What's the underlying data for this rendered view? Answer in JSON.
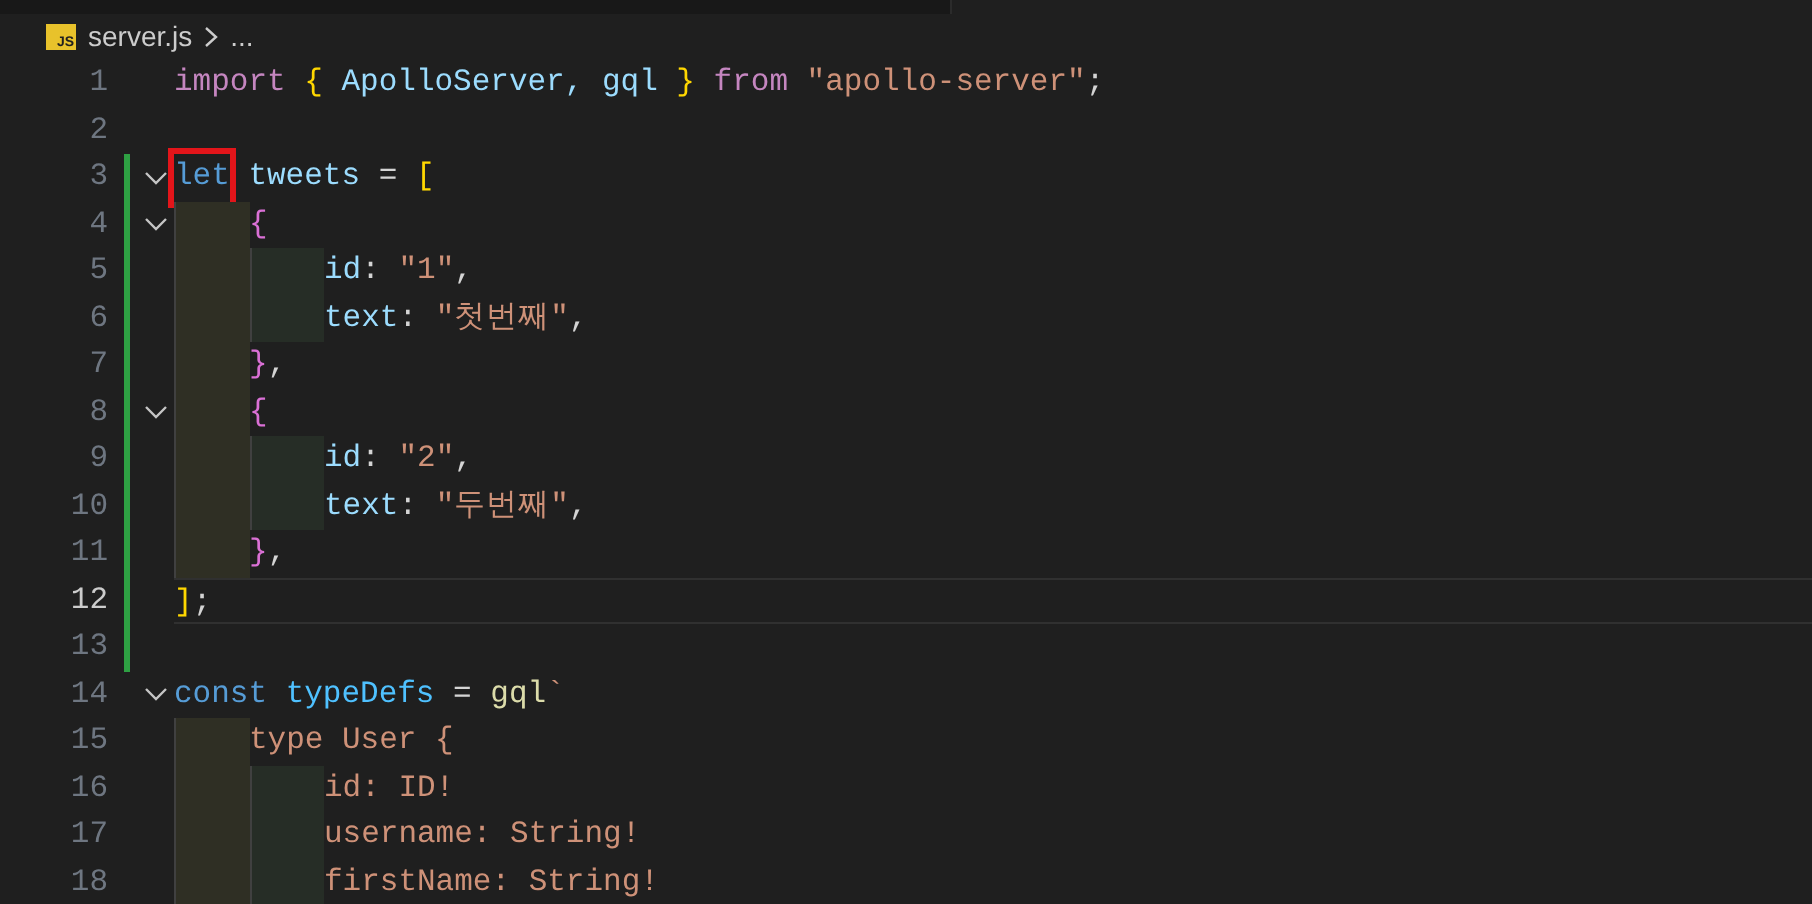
{
  "breadcrumb": {
    "file_icon": "JS",
    "file": "server.js",
    "rest": "..."
  },
  "lines": [
    {
      "number": "1",
      "foldable": false,
      "changed": false,
      "current": false,
      "tokens": [
        {
          "text": "import ",
          "kind": "control"
        },
        {
          "text": "{",
          "kind": "bracket1"
        },
        {
          "text": " ApolloServer, gql ",
          "kind": "variable"
        },
        {
          "text": "}",
          "kind": "bracket1"
        },
        {
          "text": " from ",
          "kind": "control"
        },
        {
          "text": "\"apollo-server\"",
          "kind": "string"
        },
        {
          "text": ";",
          "kind": "plain"
        }
      ]
    },
    {
      "number": "2",
      "foldable": false,
      "changed": false,
      "current": false
    },
    {
      "number": "3",
      "foldable": true,
      "changed": true,
      "current": false,
      "tokens": [
        {
          "text": "let",
          "kind": "storage",
          "boxed": true
        },
        {
          "text": " tweets ",
          "kind": "variable"
        },
        {
          "text": "= ",
          "kind": "plain"
        },
        {
          "text": "[",
          "kind": "bracket1"
        }
      ],
      "children": [
        {
          "number": "4",
          "foldable": true,
          "changed": true,
          "current": false,
          "tokens": [
            {
              "text": "{",
              "kind": "bracket2"
            }
          ],
          "children": [
            {
              "number": "5",
              "foldable": false,
              "changed": true,
              "current": false,
              "tokens": [
                {
                  "text": "id",
                  "kind": "variable"
                },
                {
                  "text": ": ",
                  "kind": "plain"
                },
                {
                  "text": "\"1\"",
                  "kind": "string"
                },
                {
                  "text": ",",
                  "kind": "plain"
                }
              ]
            },
            {
              "number": "6",
              "foldable": false,
              "changed": true,
              "current": false,
              "tokens": [
                {
                  "text": "text",
                  "kind": "variable"
                },
                {
                  "text": ": ",
                  "kind": "plain"
                },
                {
                  "text": "\"첫번째\"",
                  "kind": "string"
                },
                {
                  "text": ",",
                  "kind": "plain"
                }
              ]
            }
          ]
        },
        {
          "number": "7",
          "foldable": false,
          "changed": true,
          "current": false,
          "tokens": [
            {
              "text": "}",
              "kind": "bracket2"
            },
            {
              "text": ",",
              "kind": "plain"
            }
          ]
        },
        {
          "number": "8",
          "foldable": true,
          "changed": true,
          "current": false,
          "tokens": [
            {
              "text": "{",
              "kind": "bracket2"
            }
          ],
          "children": [
            {
              "number": "9",
              "foldable": false,
              "changed": true,
              "current": false,
              "tokens": [
                {
                  "text": "id",
                  "kind": "variable"
                },
                {
                  "text": ": ",
                  "kind": "plain"
                },
                {
                  "text": "\"2\"",
                  "kind": "string"
                },
                {
                  "text": ",",
                  "kind": "plain"
                }
              ]
            },
            {
              "number": "10",
              "foldable": false,
              "changed": true,
              "current": false,
              "tokens": [
                {
                  "text": "text",
                  "kind": "variable"
                },
                {
                  "text": ": ",
                  "kind": "plain"
                },
                {
                  "text": "\"두번째\"",
                  "kind": "string"
                },
                {
                  "text": ",",
                  "kind": "plain"
                }
              ]
            }
          ]
        },
        {
          "number": "11",
          "foldable": false,
          "changed": true,
          "current": false,
          "tokens": [
            {
              "text": "}",
              "kind": "bracket2"
            },
            {
              "text": ",",
              "kind": "plain"
            }
          ]
        }
      ]
    },
    {
      "number": "12",
      "foldable": false,
      "changed": true,
      "current": true,
      "tokens": [
        {
          "text": "]",
          "kind": "bracket1"
        },
        {
          "text": ";",
          "kind": "plain"
        }
      ]
    },
    {
      "number": "13",
      "foldable": false,
      "changed": true,
      "current": false
    },
    {
      "number": "14",
      "foldable": true,
      "changed": false,
      "current": false,
      "tokens": [
        {
          "text": "const ",
          "kind": "storage"
        },
        {
          "text": "typeDefs",
          "kind": "constant"
        },
        {
          "text": " = ",
          "kind": "plain"
        },
        {
          "text": "gql",
          "kind": "function"
        },
        {
          "text": "`",
          "kind": "string"
        }
      ],
      "children": [
        {
          "number": "15",
          "foldable": false,
          "changed": false,
          "current": false,
          "tokens": [
            {
              "text": "type User {",
              "kind": "string"
            }
          ],
          "children": [
            {
              "number": "16",
              "foldable": false,
              "changed": false,
              "current": false,
              "tokens": [
                {
                  "text": "id: ID!",
                  "kind": "string"
                }
              ]
            },
            {
              "number": "17",
              "foldable": false,
              "changed": false,
              "current": false,
              "tokens": [
                {
                  "text": "username: String!",
                  "kind": "string"
                }
              ]
            },
            {
              "number": "18",
              "foldable": false,
              "changed": false,
              "current": false,
              "tokens": [
                {
                  "text": "firstName: String!",
                  "kind": "string"
                }
              ]
            }
          ]
        }
      ]
    }
  ]
}
